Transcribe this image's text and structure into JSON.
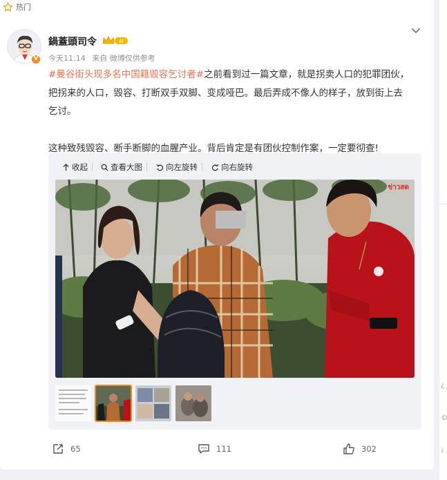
{
  "section": {
    "hot_label": "热门"
  },
  "post": {
    "author": "鍋蓋頭司令",
    "vip_level": "II",
    "verified_badge": "V",
    "time": "今天11:14",
    "source": "来自 微博仅供参考",
    "hashtag": "#曼谷街头现多名中国籍毁容乞讨者#",
    "line1_rest": "之前看到过一篇文章，就是拐卖人口的犯罪团伙，",
    "line2": "把拐来的人口，毁容、打断双手双脚、变成哑巴。最后弄成不像人的样子，放到街上去",
    "line3": "乞讨。",
    "line4": "这种致残毁容、断手断脚的血腥产业。背后肯定是有团伙控制作案，一定要彻查!",
    "media_toolbar": {
      "collapse": "收起",
      "view_large": "查看大图",
      "rotate_left": "向左旋转",
      "rotate_right": "向右旋转"
    },
    "photo_watermark": "ข่าวสด",
    "stats": {
      "reposts": "65",
      "comments": "111",
      "likes": "302"
    }
  },
  "colors": {
    "accent": "#eb7350",
    "vip": "#f08a1c",
    "card": "#ffffff",
    "page_bg": "#f0f1f4"
  },
  "icons": [
    "star-icon",
    "chevron-down-icon",
    "collapse-icon",
    "zoom-icon",
    "rotate-left-icon",
    "rotate-right-icon",
    "repost-icon",
    "comment-icon",
    "like-icon"
  ]
}
